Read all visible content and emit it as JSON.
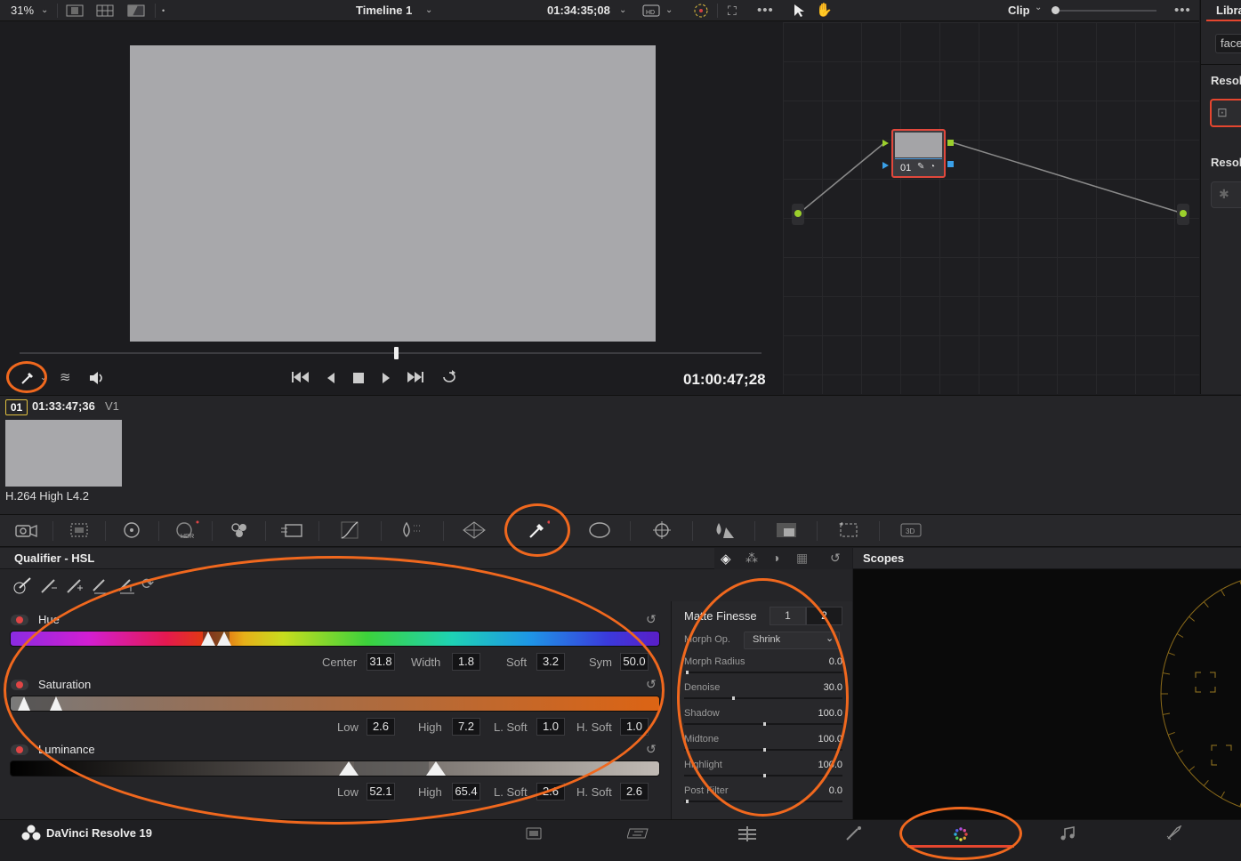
{
  "viewer": {
    "zoom": "31%",
    "timeline_name": "Timeline 1",
    "source_timecode": "01:34:35;08",
    "playhead_timecode": "01:00:47;28"
  },
  "node_editor": {
    "mode": "Clip",
    "node_label": "01"
  },
  "library": {
    "tab": "Libra",
    "search_placeholder": "face",
    "section1": "Resol",
    "section2": "Resol"
  },
  "clip": {
    "number": "01",
    "timecode": "01:33:47;36",
    "track": "V1",
    "codec": "H.264 High L4.2"
  },
  "palette_tools": [
    "camera-raw",
    "color-match",
    "color-wheels",
    "hdr",
    "rgb-mixer",
    "motion-effects",
    "curves",
    "color-warper",
    "qualifier",
    "window",
    "tracker",
    "magic-mask",
    "blur",
    "key",
    "sizing",
    "3d"
  ],
  "qualifier": {
    "title": "Qualifier - HSL",
    "hue": {
      "label": "Hue",
      "center_label": "Center",
      "center": "31.8",
      "width_label": "Width",
      "width": "1.8",
      "soft_label": "Soft",
      "soft": "3.2",
      "sym_label": "Sym",
      "sym": "50.0"
    },
    "saturation": {
      "label": "Saturation",
      "low_label": "Low",
      "low": "2.6",
      "high_label": "High",
      "high": "7.2",
      "lsoft_label": "L. Soft",
      "lsoft": "1.0",
      "hsoft_label": "H. Soft",
      "hsoft": "1.0"
    },
    "luminance": {
      "label": "Luminance",
      "low_label": "Low",
      "low": "52.1",
      "high_label": "High",
      "high": "65.4",
      "lsoft_label": "L. Soft",
      "lsoft": "2.6",
      "hsoft_label": "H. Soft",
      "hsoft": "2.6"
    }
  },
  "matte_finesse": {
    "title": "Matte Finesse",
    "tab1": "1",
    "tab2": "2",
    "morph_op_label": "Morph Op.",
    "morph_op": "Shrink",
    "rows": [
      {
        "label": "Morph Radius",
        "value": "0.0",
        "level": 0
      },
      {
        "label": "Denoise",
        "value": "30.0",
        "level": 0.3
      },
      {
        "label": "Shadow",
        "value": "100.0",
        "level": 0.5
      },
      {
        "label": "Midtone",
        "value": "100.0",
        "level": 0.5
      },
      {
        "label": "Highlight",
        "value": "100.0",
        "level": 0.5
      },
      {
        "label": "Post Filter",
        "value": "0.0",
        "level": 0
      }
    ]
  },
  "scopes": {
    "title": "Scopes"
  },
  "app": {
    "name": "DaVinci Resolve 19",
    "pages": [
      "media",
      "cut",
      "edit",
      "fusion",
      "color",
      "fairlight",
      "deliver"
    ],
    "active_page": "color"
  },
  "accent_color": "#f0681e"
}
